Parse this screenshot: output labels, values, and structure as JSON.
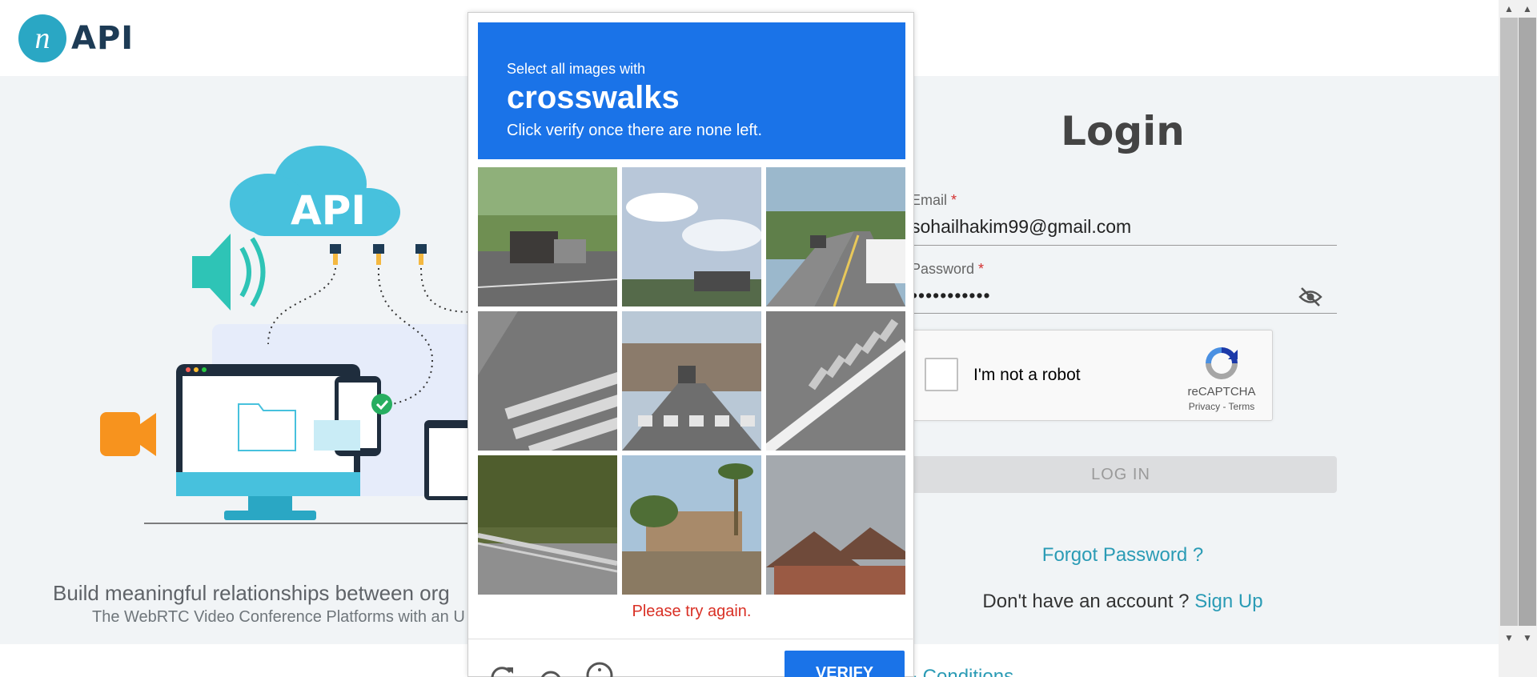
{
  "header": {
    "logo_mark": "n",
    "logo_text": "API"
  },
  "hero": {
    "cloud_label": "API"
  },
  "tagline": "Build meaningful relationships between org",
  "subtagline": "The WebRTC Video Conference Platforms with an U",
  "login": {
    "title": "Login",
    "email_label": "Email",
    "email_value": "sohailhakim99@gmail.com",
    "password_label": "Password",
    "password_value": "•••••••••••",
    "required_mark": "*",
    "login_button": "LOG IN",
    "forgot": "Forgot Password ?",
    "no_account": "Don't have an account ?",
    "signup": "Sign Up",
    "terms": "& Conditions"
  },
  "recaptcha": {
    "label": "I'm not a robot",
    "brand": "reCAPTCHA",
    "links": "Privacy - Terms"
  },
  "captcha": {
    "instruction_small": "Select all images with",
    "instruction_big": "crosswalks",
    "instruction_sub": "Click verify once there are none left.",
    "error": "Please try again.",
    "verify": "VERIFY",
    "tiles": [
      "truck on highway",
      "sky and buildings",
      "road with mail truck",
      "crosswalk close-up",
      "street with crosswalk",
      "road marking stripes",
      "guardrail by trees",
      "palm trees and houses",
      "house roof"
    ]
  },
  "colors": {
    "accent": "#2a9bb5",
    "captcha_blue": "#1a73e8",
    "error": "#d93025"
  },
  "icons": [
    "eye-off-icon",
    "reload-icon",
    "audio-icon",
    "info-icon",
    "recaptcha-logo-icon",
    "checkbox-icon"
  ]
}
